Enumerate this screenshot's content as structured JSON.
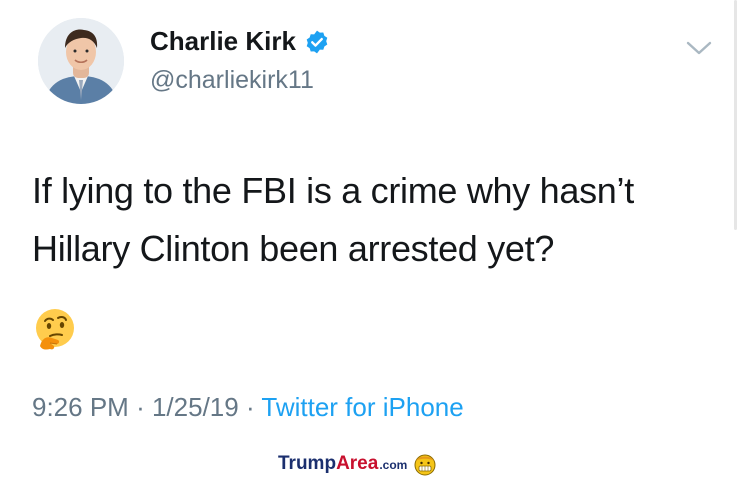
{
  "tweet": {
    "author": {
      "display_name": "Charlie Kirk",
      "handle": "@charliekirk11",
      "verified": true
    },
    "text_line1": "If lying to the FBI is a crime why hasn’t",
    "text_line2": "Hillary Clinton been arrested yet?",
    "emoji": "thinking-face",
    "time": "9:26 PM",
    "separator": "·",
    "date": "1/25/19",
    "source": "Twitter for iPhone"
  },
  "watermark": {
    "part1": "Trump",
    "part2": "Area",
    "suffix": ".com"
  },
  "colors": {
    "text": "#14171a",
    "secondary": "#657786",
    "link": "#1da1f2",
    "verified": "#1da1f2"
  }
}
